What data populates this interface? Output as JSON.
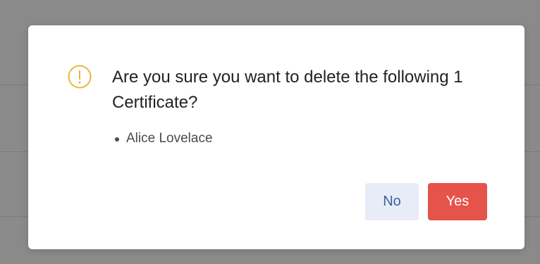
{
  "dialog": {
    "icon": "warning-circle-icon",
    "title": "Are you sure you want to delete the following 1 Certificate?",
    "items": [
      "Alice Lovelace"
    ],
    "buttons": {
      "no_label": "No",
      "yes_label": "Yes"
    },
    "colors": {
      "warning": "#e8b73c",
      "danger": "#e5534b",
      "secondary_bg": "#e7ecf6",
      "secondary_text": "#3f5fa6",
      "backdrop": "#8a8a8a"
    }
  }
}
